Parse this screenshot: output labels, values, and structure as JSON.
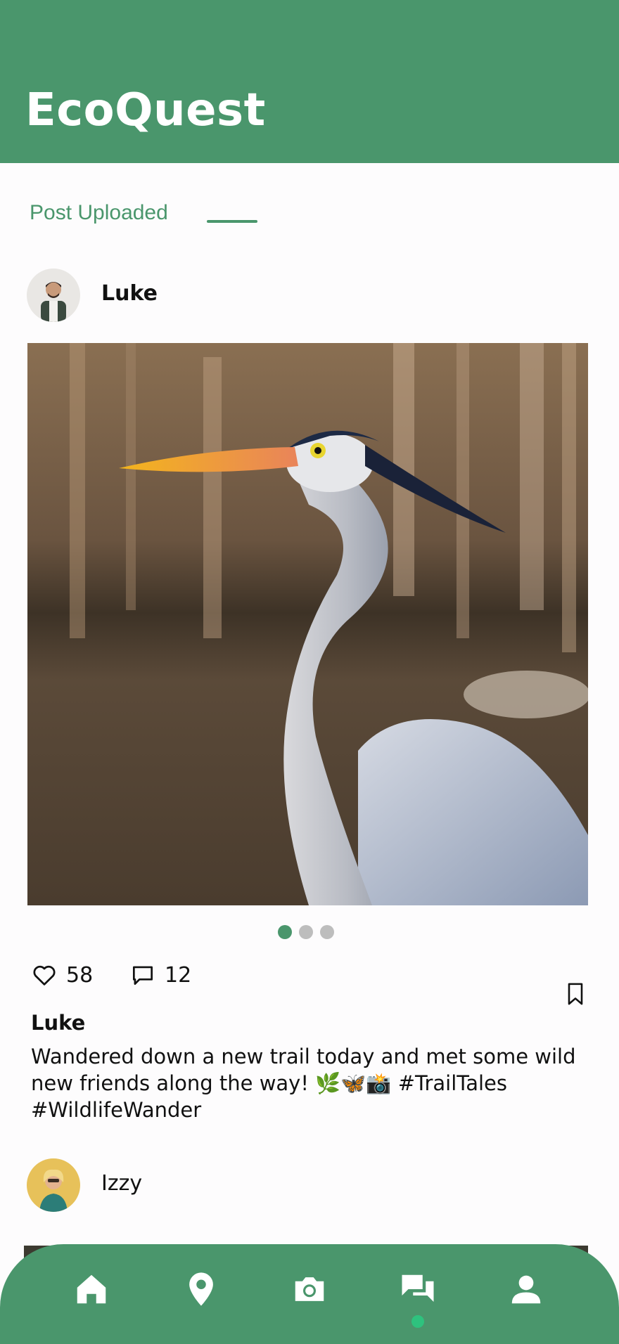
{
  "app": {
    "title": "EcoQuest"
  },
  "status": {
    "text": "Post Uploaded"
  },
  "posts": [
    {
      "author": "Luke",
      "avatar_icon": "person-avatar",
      "image_icon": "heron-photo",
      "carousel": {
        "count": 3,
        "active_index": 0
      },
      "likes": "58",
      "comments": "12",
      "caption_author": "Luke",
      "caption": "Wandered down a new trail today and met some wild new friends along the way! 🌿🦋📸 #TrailTales #WildlifeWander"
    },
    {
      "author": "Izzy",
      "avatar_icon": "person-avatar"
    }
  ],
  "bottom_nav": {
    "items": [
      {
        "icon": "home-icon"
      },
      {
        "icon": "map-pin-icon"
      },
      {
        "icon": "camera-icon"
      },
      {
        "icon": "chat-icon",
        "active": true
      },
      {
        "icon": "profile-icon"
      }
    ]
  },
  "colors": {
    "brand": "#4a966c",
    "indicator": "#2ec27e",
    "inactive_dot": "#bdbdbd"
  }
}
